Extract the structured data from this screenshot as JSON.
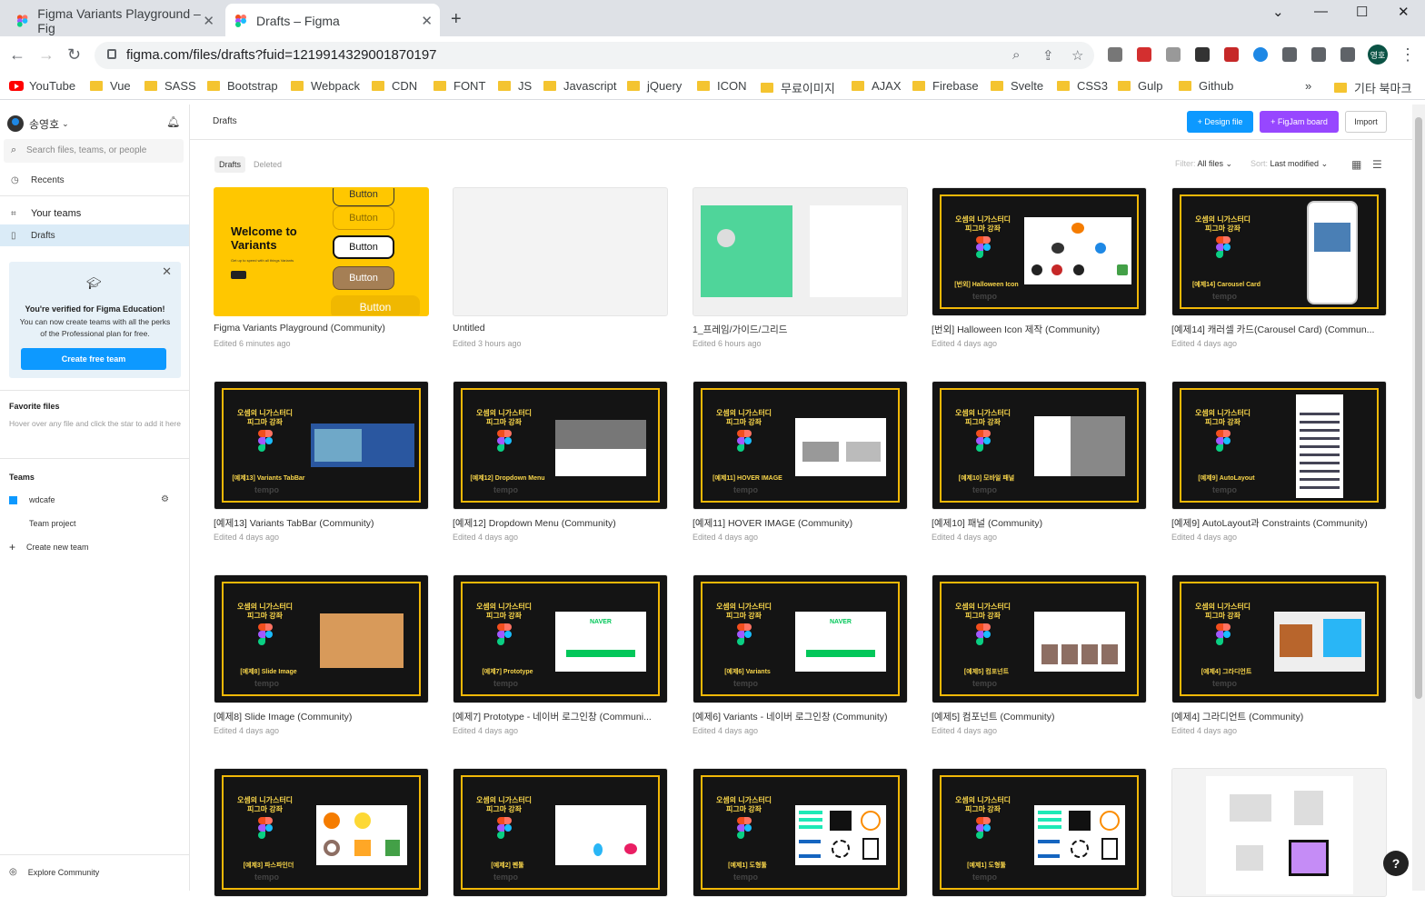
{
  "browser": {
    "tabs": [
      {
        "title": "Figma Variants Playground – Fig"
      },
      {
        "title": "Drafts – Figma"
      }
    ],
    "url": "figma.com/files/drafts?fuid=1219914329001870197",
    "profile_initials": "영호",
    "bookmarks": [
      "YouTube",
      "Vue",
      "SASS",
      "Bootstrap",
      "Webpack",
      "CDN",
      "FONT",
      "JS",
      "Javascript",
      "jQuery",
      "ICON",
      "무료이미지",
      "AJAX",
      "Firebase",
      "Svelte",
      "CSS3",
      "Gulp",
      "Github"
    ],
    "bookmarks_overflow": "»",
    "other_bookmarks": "기타 북마크"
  },
  "sidebar": {
    "user_name": "송영호",
    "search_placeholder": "Search files, teams, or people",
    "recents": "Recents",
    "your_teams": "Your teams",
    "drafts": "Drafts",
    "edu": {
      "title": "You're verified for Figma Education!",
      "text": "You can now create teams with all the perks of the Professional plan for free.",
      "button": "Create free team"
    },
    "favorites_title": "Favorite files",
    "favorites_text": "Hover over any file and click the star to add it here",
    "teams_title": "Teams",
    "team_name": "wdcafe",
    "team_project": "Team project",
    "create_team": "Create new team",
    "explore": "Explore Community"
  },
  "header": {
    "title": "Drafts",
    "design_file": "+ Design file",
    "figjam": "+ FigJam board",
    "import": "Import",
    "colors": {
      "design": "#0d99ff",
      "figjam": "#9747ff"
    }
  },
  "filters": {
    "tab_drafts": "Drafts",
    "tab_deleted": "Deleted",
    "filter_label": "Filter:",
    "filter_value": "All files",
    "sort_label": "Sort:",
    "sort_value": "Last modified"
  },
  "thumb_text": {
    "course_line1": "오셈의 니가스터디",
    "course_line2": "피그마 강좌",
    "tempo": "tempo",
    "welcome": "Welcome to Variants",
    "welcome_sub": "Get up to speed with all things Variants",
    "button": "Button",
    "naver": "NAVER"
  },
  "files": [
    {
      "name": "Figma Variants Playground (Community)",
      "edited": "Edited 6 minutes ago",
      "thumb": "yellow"
    },
    {
      "name": "Untitled",
      "edited": "Edited 3 hours ago",
      "thumb": "blank"
    },
    {
      "name": "1_프레임/가이드/그리드",
      "edited": "Edited 6 hours ago",
      "thumb": "green"
    },
    {
      "name": "[번외] Halloween Icon 제작 (Community)",
      "edited": "Edited 4 days ago",
      "thumb": "dark",
      "label": "[번외] Halloween Icon"
    },
    {
      "name": "[예제14] 캐러셀 카드(Carousel Card) (Commun...",
      "edited": "Edited 4 days ago",
      "thumb": "dark",
      "label": "[예제14] Carousel Card"
    },
    {
      "name": "[예제13] Variants TabBar (Community)",
      "edited": "Edited 4 days ago",
      "thumb": "dark",
      "label": "[예제13] Variants TabBar"
    },
    {
      "name": "[예제12] Dropdown Menu (Community)",
      "edited": "Edited 4 days ago",
      "thumb": "dark",
      "label": "[예제12] Dropdown Menu"
    },
    {
      "name": "[예제11] HOVER IMAGE (Community)",
      "edited": "Edited 4 days ago",
      "thumb": "dark",
      "label": "[예제11] HOVER IMAGE"
    },
    {
      "name": "[예제10] 패널 (Community)",
      "edited": "Edited 4 days ago",
      "thumb": "dark",
      "label": "[예제10] 모바일 패널"
    },
    {
      "name": "[예제9] AutoLayout과 Constraints (Community)",
      "edited": "Edited 4 days ago",
      "thumb": "dark",
      "label": "[예제9] AutoLayout"
    },
    {
      "name": "[예제8] Slide Image (Community)",
      "edited": "Edited 4 days ago",
      "thumb": "dark",
      "label": "[예제8] Slide Image"
    },
    {
      "name": "[예제7] Prototype - 네이버 로그인창 (Communi...",
      "edited": "Edited 4 days ago",
      "thumb": "dark",
      "label": "[예제7] Prototype"
    },
    {
      "name": "[예제6] Variants - 네이버 로그인창 (Community)",
      "edited": "Edited 4 days ago",
      "thumb": "dark",
      "label": "[예제6] Variants"
    },
    {
      "name": "[예제5] 컴포넌트 (Community)",
      "edited": "Edited 4 days ago",
      "thumb": "dark",
      "label": "[예제5] 컴포넌트"
    },
    {
      "name": "[예제4] 그라디언트 (Community)",
      "edited": "Edited 4 days ago",
      "thumb": "dark",
      "label": "[예제4] 그라디언트"
    },
    {
      "name": "",
      "edited": "",
      "thumb": "dark",
      "label": "[예제3] 파스파인더"
    },
    {
      "name": "",
      "edited": "",
      "thumb": "dark",
      "label": "[예제2] 펜툴"
    },
    {
      "name": "",
      "edited": "",
      "thumb": "dark",
      "label": "[예제1] 도형툴"
    },
    {
      "name": "",
      "edited": "",
      "thumb": "dark",
      "label": "[예제1] 도형툴"
    },
    {
      "name": "",
      "edited": "",
      "thumb": "light",
      "label": ""
    }
  ]
}
